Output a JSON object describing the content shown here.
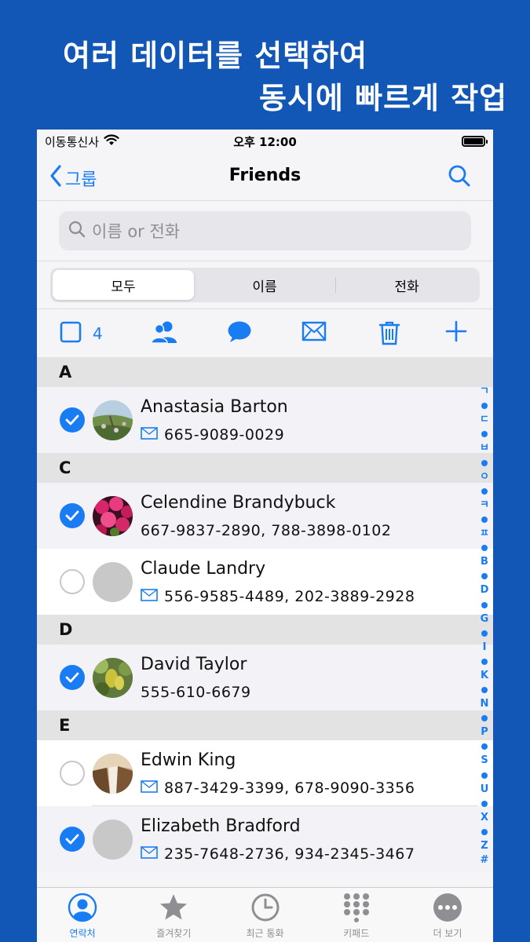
{
  "promo": {
    "line1": "여러 데이터를 선택하여",
    "line2": "동시에 빠르게 작업"
  },
  "status_bar": {
    "carrier": "이동통신사",
    "time": "오후 12:00"
  },
  "navbar": {
    "back_label": "그룹",
    "title": "Friends"
  },
  "search": {
    "placeholder": "이름 or 전화"
  },
  "segments": [
    "모두",
    "이름",
    "전화"
  ],
  "segment_selected": "모두",
  "toolbar": {
    "selected_count": "4"
  },
  "sections": [
    {
      "letter": "A",
      "contacts": [
        {
          "name": "Anastasia Barton",
          "phone": "665-9089-0029",
          "selected": true,
          "mail_icon": true,
          "avatar": "photo-flowers-field"
        }
      ]
    },
    {
      "letter": "C",
      "contacts": [
        {
          "name": "Celendine Brandybuck",
          "phone": "667-9837-2890, 788-3898-0102",
          "selected": true,
          "mail_icon": false,
          "avatar": "photo-pink-flowers"
        },
        {
          "name": "Claude Landry",
          "phone": "556-9585-4489, 202-3889-2928",
          "selected": false,
          "mail_icon": true,
          "avatar": "placeholder"
        }
      ]
    },
    {
      "letter": "D",
      "contacts": [
        {
          "name": "David Taylor",
          "phone": "555-610-6679",
          "selected": true,
          "mail_icon": false,
          "avatar": "photo-green-fruit"
        }
      ]
    },
    {
      "letter": "E",
      "contacts": [
        {
          "name": "Edwin King",
          "phone": "887-3429-3399, 678-9090-3356",
          "selected": false,
          "mail_icon": true,
          "avatar": "photo-waterfall"
        },
        {
          "name": "Elizabeth Bradford",
          "phone": "235-7648-2736, 934-2345-3467",
          "selected": true,
          "mail_icon": true,
          "avatar": "placeholder"
        }
      ]
    }
  ],
  "index_letters": [
    "ㄱ",
    "ㄷ",
    "ㅂ",
    "ㅇ",
    "ㅋ",
    "ㅍ",
    "B",
    "D",
    "G",
    "I",
    "K",
    "N",
    "P",
    "S",
    "U",
    "X",
    "Z",
    "#"
  ],
  "tabs": [
    {
      "label": "연락처",
      "icon": "person-circle-icon",
      "active": true
    },
    {
      "label": "즐겨찾기",
      "icon": "star-icon",
      "active": false
    },
    {
      "label": "최근 통화",
      "icon": "clock-icon",
      "active": false
    },
    {
      "label": "키패드",
      "icon": "keypad-icon",
      "active": false
    },
    {
      "label": "더 보기",
      "icon": "more-icon",
      "active": false
    }
  ],
  "colors": {
    "background": "#1357b6",
    "accent": "#1a7cf3",
    "section_header": "#e3e3e3"
  }
}
